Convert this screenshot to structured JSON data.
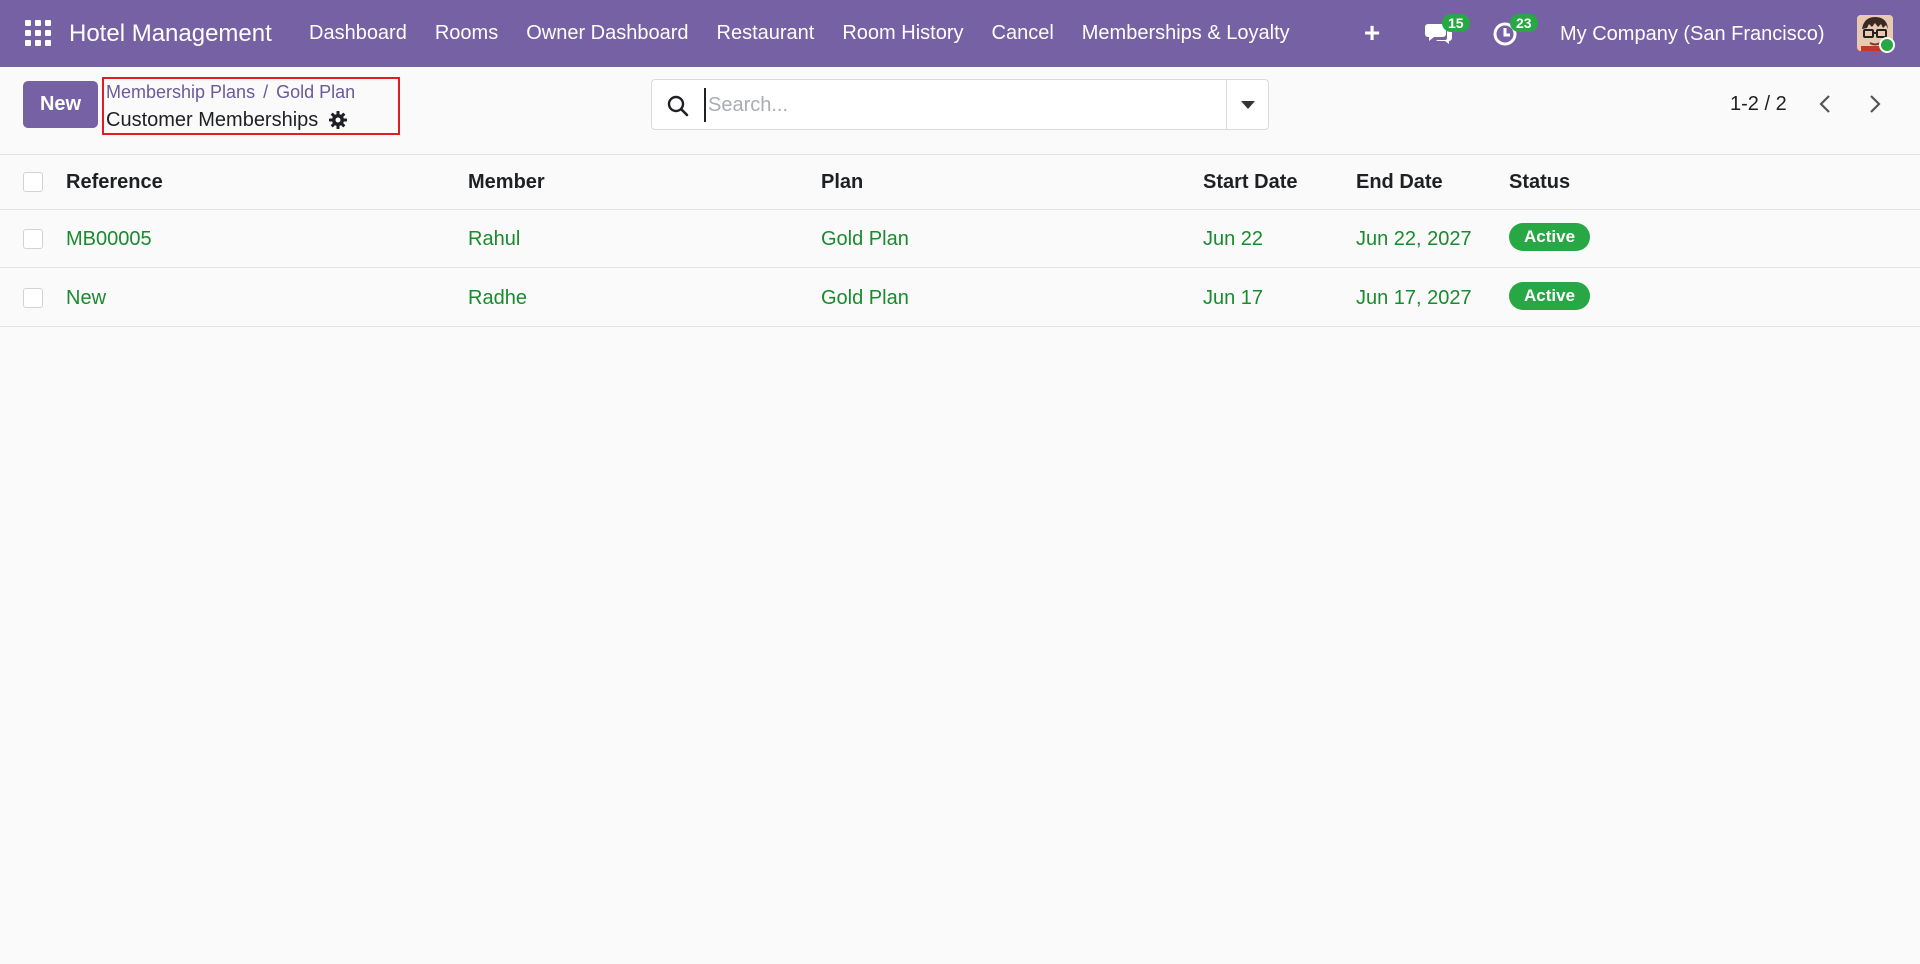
{
  "navbar": {
    "app_name": "Hotel Management",
    "menu": [
      "Dashboard",
      "Rooms",
      "Owner Dashboard",
      "Restaurant",
      "Room History",
      "Cancel",
      "Memberships & Loyalty"
    ],
    "plus_label": "+",
    "messages_count": "15",
    "activities_count": "23",
    "company": "My Company (San Francisco)",
    "accent_color": "#7561a3"
  },
  "control_panel": {
    "new_label": "New",
    "breadcrumb": [
      "Membership Plans",
      "Gold Plan"
    ],
    "breadcrumb_separator": "/",
    "title": "Customer Memberships",
    "search_placeholder": "Search...",
    "pager": "1-2 / 2"
  },
  "table": {
    "headers": {
      "reference": "Reference",
      "member": "Member",
      "plan": "Plan",
      "start_date": "Start Date",
      "end_date": "End Date",
      "status": "Status"
    },
    "rows": [
      {
        "reference": "MB00005",
        "member": "Rahul",
        "plan": "Gold Plan",
        "start_date": "Jun 22",
        "end_date": "Jun 22, 2027",
        "status": "Active"
      },
      {
        "reference": "New",
        "member": "Radhe",
        "plan": "Gold Plan",
        "start_date": "Jun 17",
        "end_date": "Jun 17, 2027",
        "status": "Active"
      }
    ],
    "link_color": "#1a8a2f",
    "status_color": "#28a745"
  }
}
